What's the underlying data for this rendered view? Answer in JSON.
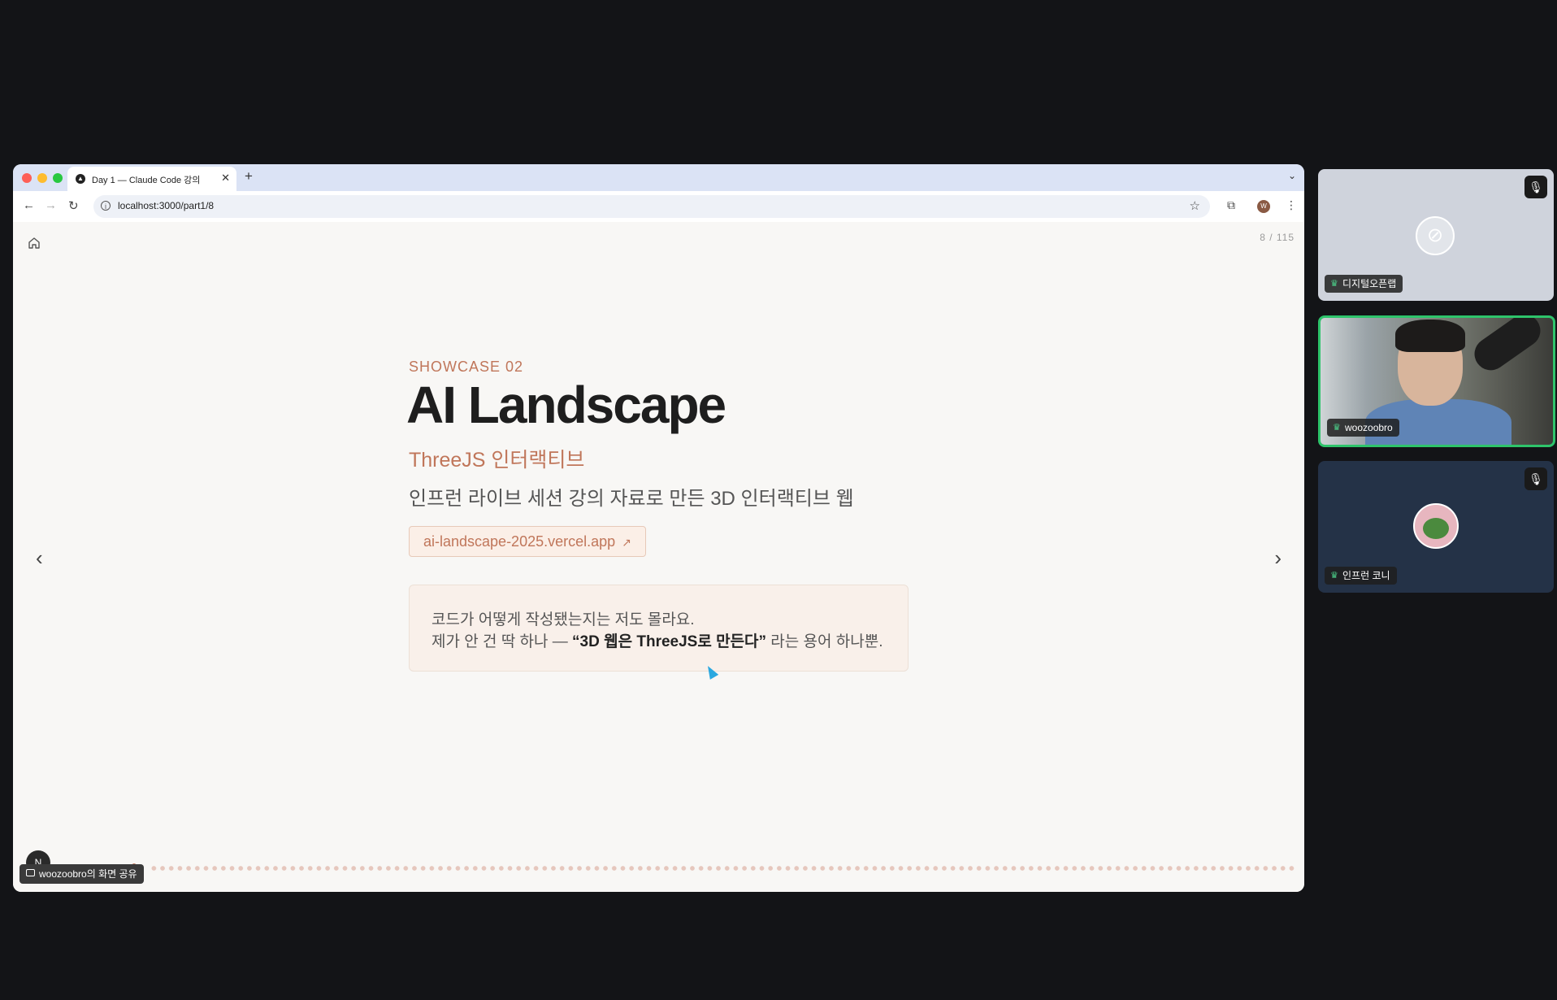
{
  "browser": {
    "tab_title": "Day 1 — Claude Code 강의",
    "url": "localhost:3000/part1/8"
  },
  "slide": {
    "counter": "8 / 115",
    "kicker": "SHOWCASE 02",
    "title": "AI Landscape",
    "subtitle": "ThreeJS 인터랙티브",
    "description": "인프런 라이브 세션 강의 자료로 만든 3D 인터랙티브 웹",
    "link_text": "ai-landscape-2025.vercel.app",
    "quote_line1": "코드가 어떻게 작성됐는지는 저도 몰라요.",
    "quote_line2_before": "제가 안 건 딱 하나 — ",
    "quote_line2_bold": "“3D 웹은 ThreeJS로 만든다”",
    "quote_line2_after": " 라는 용어 하나뿐.",
    "accent_color": "#c0765a"
  },
  "screen_share": {
    "label": "woozoobro의 화면 공유"
  },
  "participants": [
    {
      "name": "디지털오픈랩",
      "muted": true,
      "camera": "off"
    },
    {
      "name": "woozoobro",
      "muted": false,
      "camera": "on",
      "speaking": true
    },
    {
      "name": "인프런 코니",
      "muted": true,
      "camera": "avatar"
    }
  ]
}
